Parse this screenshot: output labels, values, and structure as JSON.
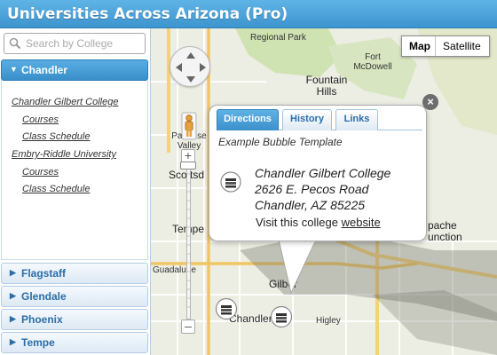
{
  "app": {
    "title": "Universities Across Arizona (Pro)"
  },
  "search": {
    "placeholder": "Search by College"
  },
  "sidebar": {
    "sections": [
      {
        "label": "Chandler",
        "expanded": true
      },
      {
        "label": "Flagstaff",
        "expanded": false
      },
      {
        "label": "Glendale",
        "expanded": false
      },
      {
        "label": "Phoenix",
        "expanded": false
      },
      {
        "label": "Tempe",
        "expanded": false
      }
    ],
    "chandler_colleges": [
      {
        "name": "Chandler Gilbert College",
        "links": [
          "Courses",
          "Class Schedule"
        ]
      },
      {
        "name": "Embry-Riddle University",
        "links": [
          "Courses",
          "Class Schedule"
        ]
      }
    ]
  },
  "map": {
    "type_buttons": {
      "map": "Map",
      "satellite": "Satellite",
      "selected": "Map"
    },
    "labels": {
      "regional_park": "Regional Park",
      "fort_mcdowell": "Fort\nMcDowell",
      "fountain_hills": "Fountain\nHills",
      "paradise_valley": "Paradise\nValley",
      "scottsdale": "Scottsd",
      "tempe": "Tempe",
      "guadalupe": "Guadalupe",
      "gilbert": "Gilber",
      "chandler": "Chandler",
      "higley": "Higley",
      "apache_junction": "pache\nunction"
    }
  },
  "bubble": {
    "tabs": [
      "Directions",
      "History",
      "Links"
    ],
    "active_tab": "Directions",
    "template_label": "Example Bubble Template",
    "college_name": "Chandler Gilbert College",
    "address_line1": "2626 E. Pecos Road",
    "address_line2": "Chandler, AZ 85225",
    "visit_prefix": "Visit this college",
    "website_link": "website",
    "close_glyph": "×"
  },
  "colors": {
    "header": "#4aa3dc",
    "accent": "#2a6ea8",
    "map_land": "#eceee3",
    "highway": "#f3d27a"
  }
}
